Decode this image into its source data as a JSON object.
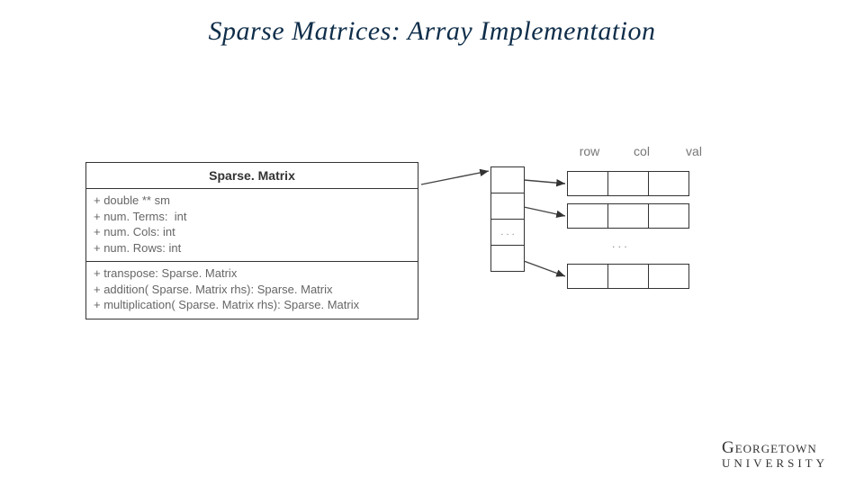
{
  "title": "Sparse Matrices: Array Implementation",
  "uml": {
    "name": "Sparse. Matrix",
    "attrs": [
      "+ double ** sm",
      "+ num. Terms:  int",
      "+ num. Cols: int",
      "+ num. Rows: int"
    ],
    "ops": [
      "+ transpose: Sparse. Matrix",
      "+ addition( Sparse. Matrix rhs): Sparse. Matrix",
      "+ multiplication( Sparse. Matrix rhs): Sparse. Matrix"
    ]
  },
  "headers": {
    "row": "row",
    "col": "col",
    "val": "val"
  },
  "ellipsis": ". . .",
  "ellipsis2": ". . .",
  "logo": {
    "line1": "Georgetown",
    "line2": "UNIVERSITY"
  }
}
